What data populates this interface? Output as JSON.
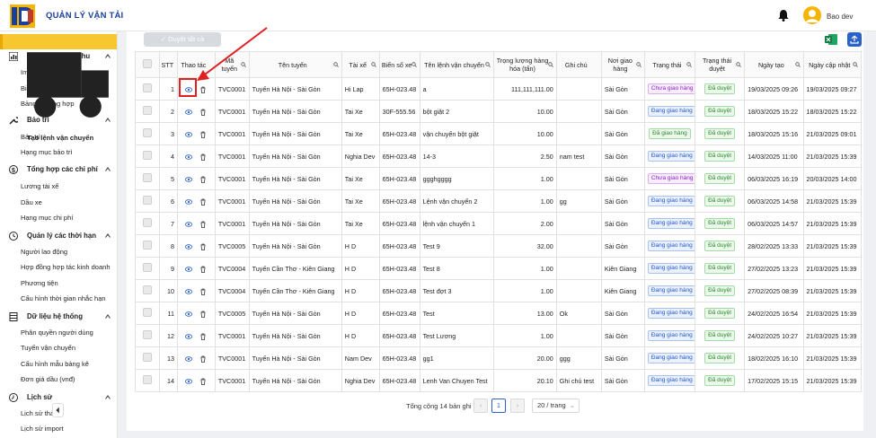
{
  "header": {
    "app_title": "QUẢN LÝ VẬN TẢI",
    "user_name": "Bao dev"
  },
  "sidebar": {
    "items": [
      {
        "type": "active",
        "label": "Tạo lệnh vận chuyển",
        "icon": "truck-icon"
      },
      {
        "type": "group",
        "label": "Báo cáo doanh thu",
        "icon": "chart-icon"
      },
      {
        "type": "sub",
        "label": "Import bảng kê"
      },
      {
        "type": "sub",
        "label": "Biểu đồ doanh thu"
      },
      {
        "type": "sub",
        "label": "Bảng kê tổng hợp"
      },
      {
        "type": "group",
        "label": "Bảo trì",
        "icon": "wrench-icon"
      },
      {
        "type": "sub",
        "label": "Bảo trì"
      },
      {
        "type": "sub",
        "label": "Hạng mục bảo trì"
      },
      {
        "type": "group",
        "label": "Tổng hợp các chi phí",
        "icon": "dollar-icon"
      },
      {
        "type": "sub",
        "label": "Lương tài xế"
      },
      {
        "type": "sub",
        "label": "Dầu xe"
      },
      {
        "type": "sub",
        "label": "Hạng mục chi phí"
      },
      {
        "type": "group",
        "label": "Quản lý các thời hạn",
        "icon": "clock-icon"
      },
      {
        "type": "sub",
        "label": "Người lao động"
      },
      {
        "type": "sub",
        "label": "Hợp đồng hợp tác kinh doanh"
      },
      {
        "type": "sub",
        "label": "Phương tiện"
      },
      {
        "type": "sub",
        "label": "Cấu hình thời gian nhắc hạn"
      },
      {
        "type": "group",
        "label": "Dữ liệu hệ thống",
        "icon": "database-icon"
      },
      {
        "type": "sub",
        "label": "Phân quyền người dùng"
      },
      {
        "type": "sub",
        "label": "Tuyến vận chuyển"
      },
      {
        "type": "sub",
        "label": "Cấu hình mẫu bảng kê"
      },
      {
        "type": "sub",
        "label": "Đơn giá dầu (vnđ)"
      },
      {
        "type": "group",
        "label": "Lịch sử",
        "icon": "history-icon"
      },
      {
        "type": "sub",
        "label": "Lịch sử tha"
      },
      {
        "type": "sub",
        "label": "Lịch sử import"
      }
    ]
  },
  "toolbar": {
    "approve_all": "Duyệt tất cả"
  },
  "table": {
    "headers": [
      "STT",
      "Thao tác",
      "Mã tuyến",
      "Tên tuyến",
      "Tài xế",
      "Biển số xe",
      "Tên lệnh vận chuyển",
      "Trọng lượng hàng hóa (tấn)",
      "Ghi chú",
      "Nơi giao hàng",
      "Trạng thái",
      "Trạng thái duyệt",
      "Ngày tạo",
      "Ngày cập nhật"
    ],
    "rows": [
      [
        "1",
        "TVC0001",
        "Tuyến Hà Nội - Sài Gòn",
        "Hi Lap",
        "65H-023.48",
        "a",
        "111,111,111.00",
        "",
        "Sài Gòn",
        "Chưa giao hàng",
        "Đã duyệt",
        "19/03/2025 09:26",
        "19/03/2025 09:27"
      ],
      [
        "2",
        "TVC0001",
        "Tuyến Hà Nội - Sài Gòn",
        "Tai Xe",
        "30F-555.56",
        "bột giặt 2",
        "10.00",
        "",
        "Sài Gòn",
        "Đang giao hàng",
        "Đã duyệt",
        "18/03/2025 15:22",
        "18/03/2025 15:22"
      ],
      [
        "3",
        "TVC0001",
        "Tuyến Hà Nội - Sài Gòn",
        "Tai Xe",
        "65H-023.48",
        "vận chuyển bột giặt",
        "10.00",
        "",
        "Sài Gòn",
        "Đã giao hàng",
        "Đã duyệt",
        "18/03/2025 15:16",
        "21/03/2025 09:01"
      ],
      [
        "4",
        "TVC0001",
        "Tuyến Hà Nội - Sài Gòn",
        "Nghia Dev",
        "65H-023.48",
        "14-3",
        "2.50",
        "nam test",
        "Sài Gòn",
        "Đang giao hàng",
        "Đã duyệt",
        "14/03/2025 11:00",
        "21/03/2025 15:39"
      ],
      [
        "5",
        "TVC0001",
        "Tuyến Hà Nội - Sài Gòn",
        "Tai Xe",
        "65H-023.48",
        "ggghgggg",
        "1.00",
        "",
        "Sài Gòn",
        "Chưa giao hàng",
        "Đã duyệt",
        "06/03/2025 16:19",
        "20/03/2025 14:00"
      ],
      [
        "6",
        "TVC0001",
        "Tuyến Hà Nội - Sài Gòn",
        "Tai Xe",
        "65H-023.48",
        "Lệnh vận chuyển 2",
        "1.00",
        "gg",
        "Sài Gòn",
        "Đang giao hàng",
        "Đã duyệt",
        "06/03/2025 14:58",
        "21/03/2025 15:39"
      ],
      [
        "7",
        "TVC0001",
        "Tuyến Hà Nội - Sài Gòn",
        "Tai Xe",
        "65H-023.48",
        "lệnh vận chuyển 1",
        "2.00",
        "",
        "Sài Gòn",
        "Đang giao hàng",
        "Đã duyệt",
        "06/03/2025 14:57",
        "21/03/2025 15:39"
      ],
      [
        "8",
        "TVC0005",
        "Tuyến Hà Nội - Sài Gòn",
        "H D",
        "65H-023.48",
        "Test 9",
        "32.00",
        "",
        "Sài Gòn",
        "Đang giao hàng",
        "Đã duyệt",
        "28/02/2025 13:33",
        "21/03/2025 15:39"
      ],
      [
        "9",
        "TVC0004",
        "Tuyến Cần Thơ - Kiên Giang",
        "H D",
        "65H-023.48",
        "Test 8",
        "1.00",
        "",
        "Kiên Giang",
        "Đang giao hàng",
        "Đã duyệt",
        "27/02/2025 13:23",
        "21/03/2025 15:39"
      ],
      [
        "10",
        "TVC0004",
        "Tuyến Cần Thơ - Kiên Giang",
        "H D",
        "65H-023.48",
        "Test đợt 3",
        "1.00",
        "",
        "Kiên Giang",
        "Đang giao hàng",
        "Đã duyệt",
        "27/02/2025 08:39",
        "21/03/2025 15:39"
      ],
      [
        "11",
        "TVC0005",
        "Tuyến Hà Nội - Sài Gòn",
        "H D",
        "65H-023.48",
        "Test",
        "13.00",
        "Ok",
        "Sài Gòn",
        "Đang giao hàng",
        "Đã duyệt",
        "24/02/2025 16:54",
        "21/03/2025 15:39"
      ],
      [
        "12",
        "TVC0001",
        "Tuyến Hà Nội - Sài Gòn",
        "H D",
        "65H-023.48",
        "Test Lương",
        "1.00",
        "",
        "Sài Gòn",
        "Đang giao hàng",
        "Đã duyệt",
        "24/02/2025 10:27",
        "21/03/2025 15:39"
      ],
      [
        "13",
        "TVC0001",
        "Tuyến Hà Nội - Sài Gòn",
        "Nam Dev",
        "65H-023.48",
        "gg1",
        "20.00",
        "ggg",
        "Sài Gòn",
        "Đang giao hàng",
        "Đã duyệt",
        "18/02/2025 16:10",
        "21/03/2025 15:39"
      ],
      [
        "14",
        "TVC0001",
        "Tuyến Hà Nội - Sài Gòn",
        "Nghia Dev",
        "65H-023.48",
        "Lenh Van Chuyen Test",
        "20.10",
        "Ghi chú test",
        "Sài Gòn",
        "Đang giao hàng",
        "Đã duyệt",
        "17/02/2025 15:15",
        "21/03/2025 15:39"
      ]
    ]
  },
  "pagination": {
    "total_text": "Tổng cộng 14 bản ghi",
    "current_page": "1",
    "page_size": "20 / trang"
  },
  "colors": {
    "brand": "#1a3f9c",
    "active_menu": "#f7c631",
    "highlight": "#e02020"
  }
}
